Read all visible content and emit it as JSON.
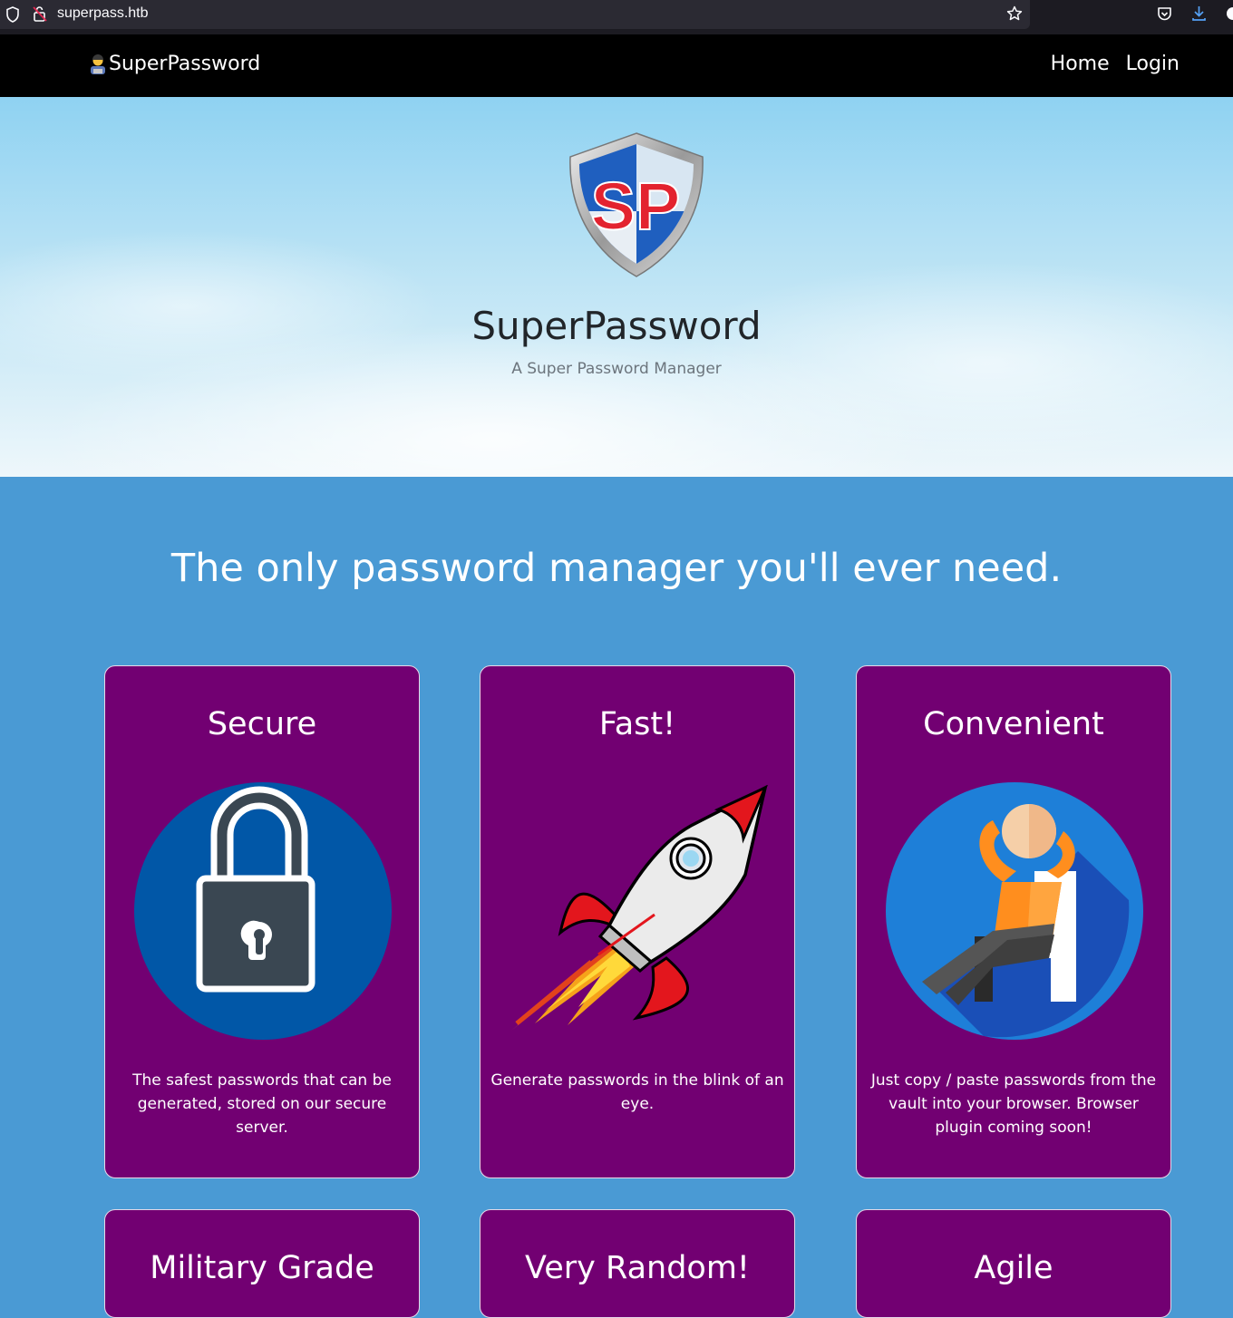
{
  "browser": {
    "url": "superpass.htb"
  },
  "navbar": {
    "brand": "SuperPassword",
    "links": [
      "Home",
      "Login"
    ]
  },
  "hero": {
    "logo_text": "SP",
    "title": "SuperPassword",
    "subtitle": "A Super Password Manager"
  },
  "main": {
    "tagline": "The only password manager you'll ever need.",
    "features": [
      {
        "title": "Secure",
        "icon": "padlock-icon",
        "text": "The safest passwords that can be generated, stored on our secure server."
      },
      {
        "title": "Fast!",
        "icon": "rocket-icon",
        "text": "Generate passwords in the blink of an eye."
      },
      {
        "title": "Convenient",
        "icon": "relaxing-person-icon",
        "text": "Just copy / paste passwords from the vault into your browser. Browser plugin coming soon!"
      },
      {
        "title": "Military Grade"
      },
      {
        "title": "Very Random!"
      },
      {
        "title": "Agile"
      }
    ]
  },
  "colors": {
    "navbar": "#000000",
    "page_background": "#4a9ad4",
    "card_background": "#720072"
  }
}
